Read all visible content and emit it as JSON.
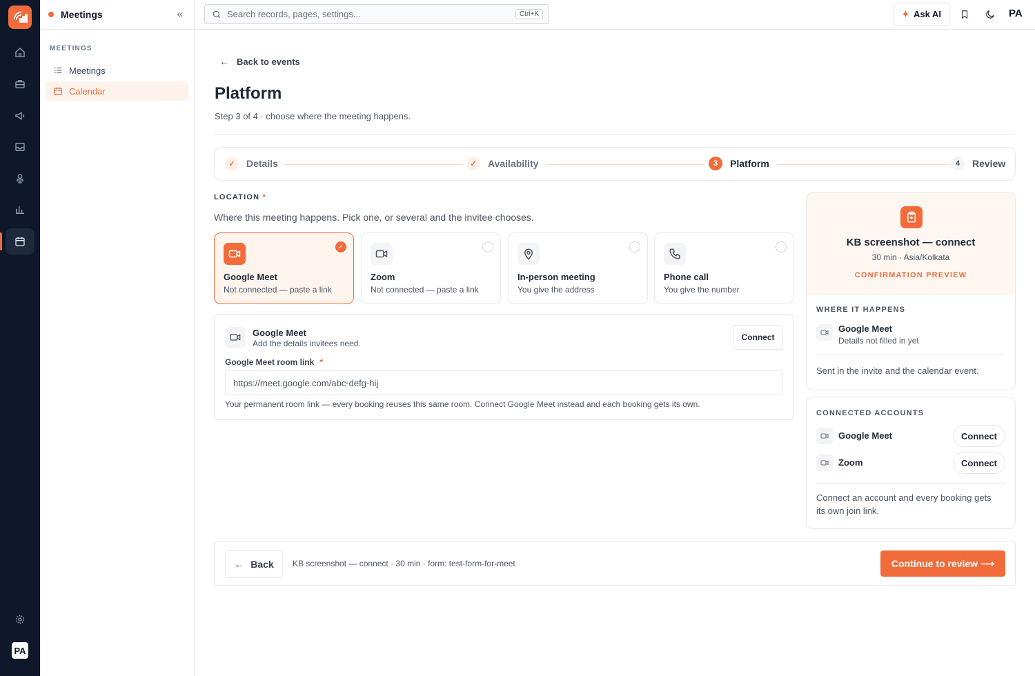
{
  "colors": {
    "accent": "#f26b3a",
    "rail": "#0f172a",
    "selected_bg": "#fdf4ee"
  },
  "sidebar": {
    "app_title": "Meetings",
    "section": "MEETINGS",
    "items": [
      {
        "label": "Meetings",
        "icon": "list-icon",
        "active": false
      },
      {
        "label": "Calendar",
        "icon": "calendar-icon",
        "active": true
      }
    ]
  },
  "topbar": {
    "search_placeholder": "Search records, pages, settings...",
    "search_shortcut": "Ctrl+K",
    "ask_ai": "Ask AI",
    "avatar": "PA"
  },
  "rail": {
    "avatar": "PA"
  },
  "page": {
    "back_link": "Back to events",
    "title": "Platform",
    "subtitle": "Step 3 of 4 · choose where the meeting happens."
  },
  "stepper": {
    "steps": [
      {
        "label": "Details",
        "badge": "✓",
        "state": "done"
      },
      {
        "label": "Availability",
        "badge": "✓",
        "state": "done"
      },
      {
        "label": "Platform",
        "badge": "3",
        "state": "current"
      },
      {
        "label": "Review",
        "badge": "4",
        "state": "todo"
      }
    ]
  },
  "location": {
    "label": "LOCATION",
    "required_mark": "*",
    "description": "Where this meeting happens. Pick one, or several and the invitee chooses.",
    "options": [
      {
        "name": "Google Meet",
        "sub": "Not connected — paste a link",
        "icon": "video-icon",
        "selected": true
      },
      {
        "name": "Zoom",
        "sub": "Not connected — paste a link",
        "icon": "video-icon",
        "selected": false
      },
      {
        "name": "In-person meeting",
        "sub": "You give the address",
        "icon": "map-pin-icon",
        "selected": false
      },
      {
        "name": "Phone call",
        "sub": "You give the number",
        "icon": "phone-icon",
        "selected": false
      }
    ]
  },
  "details": {
    "name": "Google Meet",
    "sub": "Add the details invitees need.",
    "connect": "Connect",
    "field_label": "Google Meet room link",
    "required_mark": "*",
    "field_value": "https://meet.google.com/abc-defg-hij",
    "help": "Your permanent room link — every booking reuses this same room. Connect Google Meet instead and each booking gets its own."
  },
  "preview": {
    "name": "KB screenshot — connect",
    "meta": "30 min · Asia/Kolkata",
    "confirmation": "CONFIRMATION PREVIEW",
    "where_label": "WHERE IT HAPPENS",
    "where_name": "Google Meet",
    "where_sub": "Details not filled in yet",
    "sent": "Sent in the invite and the calendar event."
  },
  "accounts": {
    "label": "CONNECTED ACCOUNTS",
    "items": [
      {
        "name": "Google Meet",
        "button": "Connect"
      },
      {
        "name": "Zoom",
        "button": "Connect"
      }
    ],
    "note": "Connect an account and every booking gets its own join link."
  },
  "footer": {
    "back": "Back",
    "summary": "KB screenshot — connect · 30 min · form: test-form-for-meet",
    "continue": "Continue to review ⟶"
  }
}
